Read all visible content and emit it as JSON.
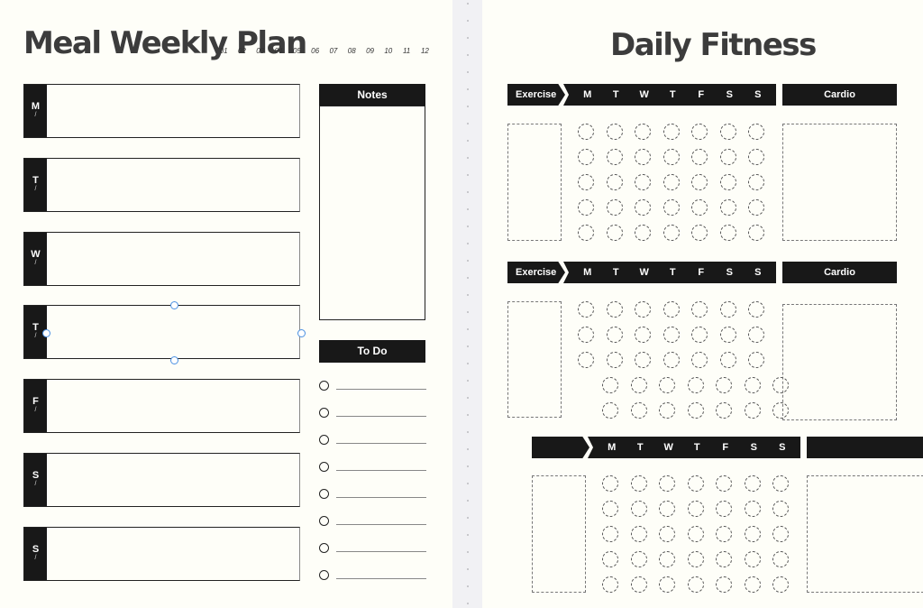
{
  "meal_plan": {
    "title": "Meal Weekly Plan",
    "months": [
      "01",
      "02",
      "03",
      "04",
      "05",
      "06",
      "07",
      "08",
      "09",
      "10",
      "11",
      "12"
    ],
    "days": [
      {
        "letter": "M",
        "sep": "/"
      },
      {
        "letter": "T",
        "sep": "/"
      },
      {
        "letter": "W",
        "sep": "/"
      },
      {
        "letter": "T",
        "sep": "/"
      },
      {
        "letter": "F",
        "sep": "/"
      },
      {
        "letter": "S",
        "sep": "/"
      },
      {
        "letter": "S",
        "sep": "/"
      }
    ],
    "selected_day_index": 3,
    "notes_label": "Notes",
    "todo_label": "To Do",
    "todo_count": 8
  },
  "fitness": {
    "title": "Daily Fitness",
    "weekdays": [
      "M",
      "T",
      "W",
      "T",
      "F",
      "S",
      "S"
    ],
    "sections": [
      {
        "exercise_label": "Exercise",
        "cardio_label": "Cardio",
        "rows": 5
      },
      {
        "exercise_label": "Exercise",
        "cardio_label": "Cardio",
        "rows": 5
      },
      {
        "exercise_label": "",
        "cardio_label": "",
        "rows": 5
      }
    ]
  },
  "colors": {
    "ink": "#181818",
    "paper": "#fefef8",
    "canvas": "#f1f1f4",
    "selection": "#4a90e2"
  }
}
